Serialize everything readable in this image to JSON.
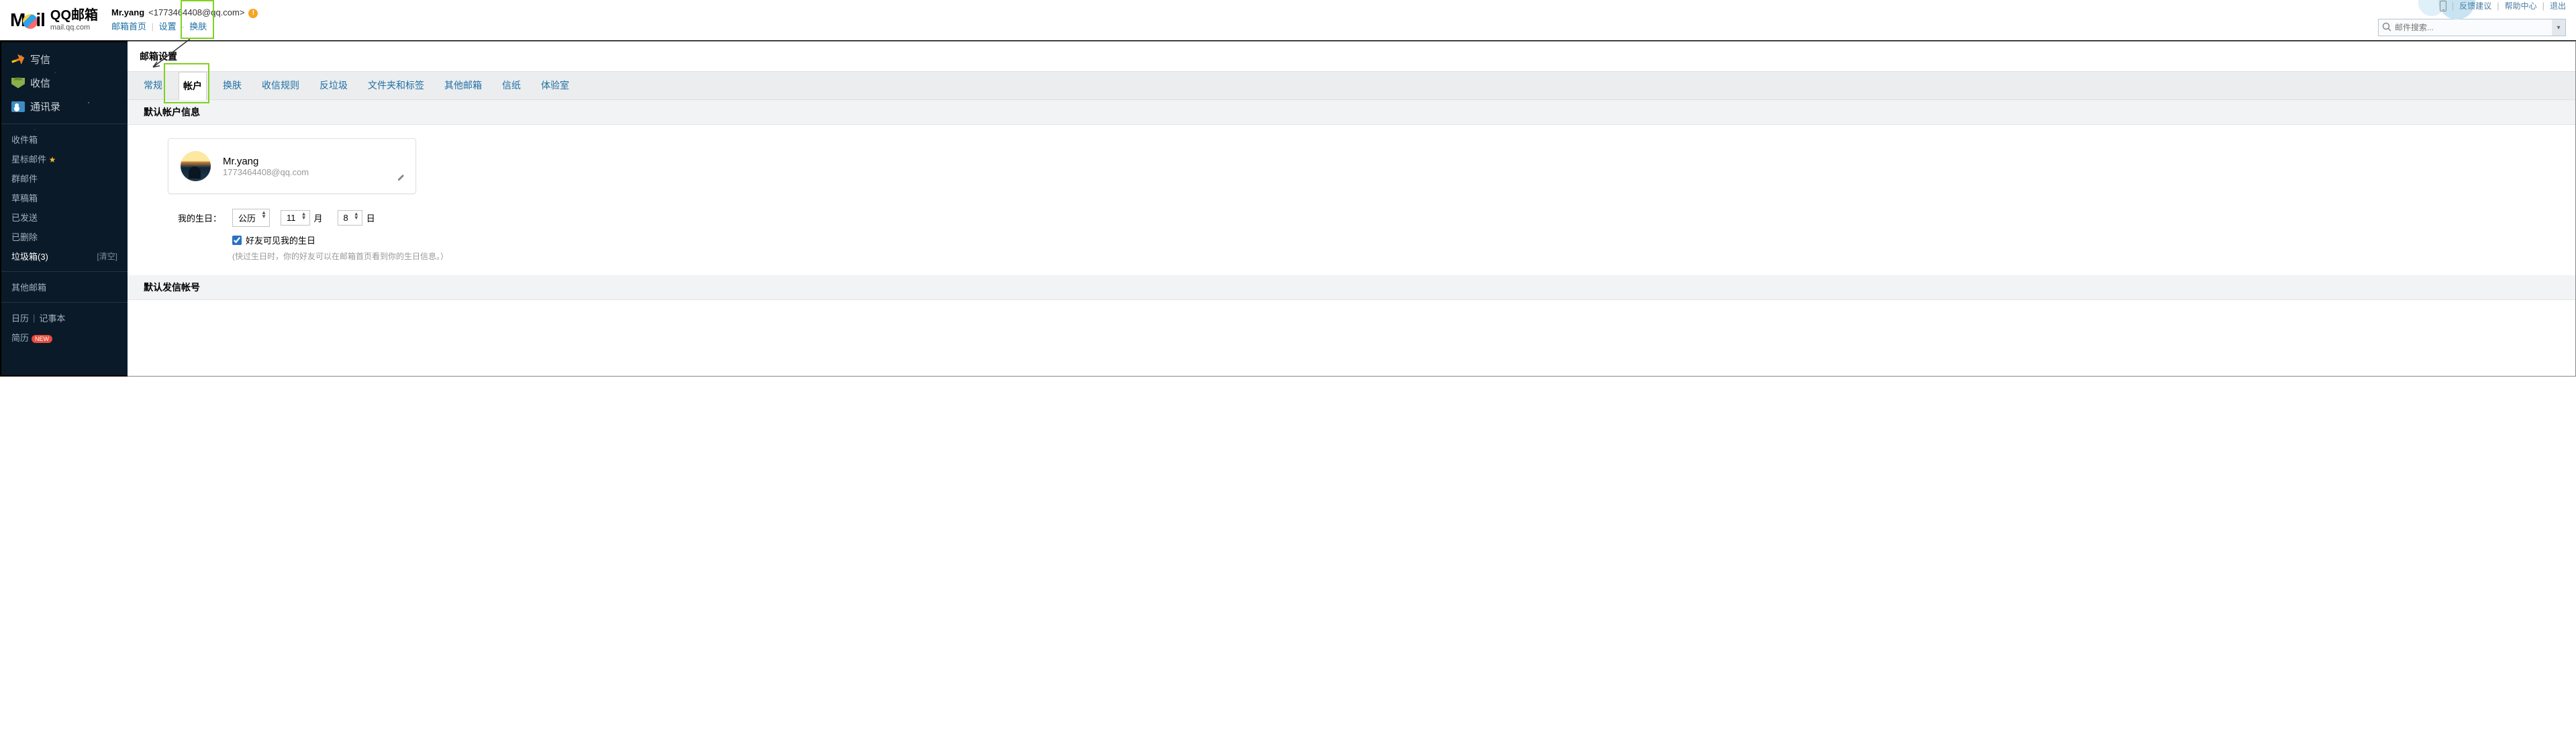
{
  "header": {
    "logo_top": "QQ邮箱",
    "logo_bot": "mail.qq.com",
    "user_name": "Mr.yang",
    "user_email": "<1773464408@qq.com>",
    "links": {
      "home": "邮箱首页",
      "settings": "设置",
      "skin": "换肤"
    },
    "top_links": {
      "feedback": "反馈建议",
      "help": "帮助中心",
      "logout": "退出"
    },
    "search_placeholder": "邮件搜索..."
  },
  "sidebar": {
    "main": {
      "write": "写信",
      "inbox": "收信",
      "contact": "通讯录"
    },
    "list": {
      "inbox": "收件箱",
      "star": "星标邮件",
      "group": "群邮件",
      "draft": "草稿箱",
      "sent": "已发送",
      "deleted": "已删除",
      "trash": "垃圾箱(3)",
      "clear": "[清空]",
      "other": "其他邮箱"
    },
    "foot": {
      "calendar": "日历",
      "notes": "记事本",
      "resume": "简历",
      "new": "NEW"
    }
  },
  "main": {
    "title": "邮箱设置",
    "tabs": [
      "常规",
      "帐户",
      "换肤",
      "收信规则",
      "反垃圾",
      "文件夹和标签",
      "其他邮箱",
      "信纸",
      "体验室"
    ],
    "section1": "默认帐户信息",
    "section2": "默认发信帐号",
    "card": {
      "name": "Mr.yang",
      "email": "1773464408@qq.com"
    },
    "birthday": {
      "label": "我的生日：",
      "calendar": "公历",
      "month": "11",
      "month_unit": "月",
      "day": "8",
      "day_unit": "日",
      "visible": "好友可见我的生日",
      "hint": "(快过生日时，你的好友可以在邮箱首页看到你的生日信息。）"
    }
  }
}
